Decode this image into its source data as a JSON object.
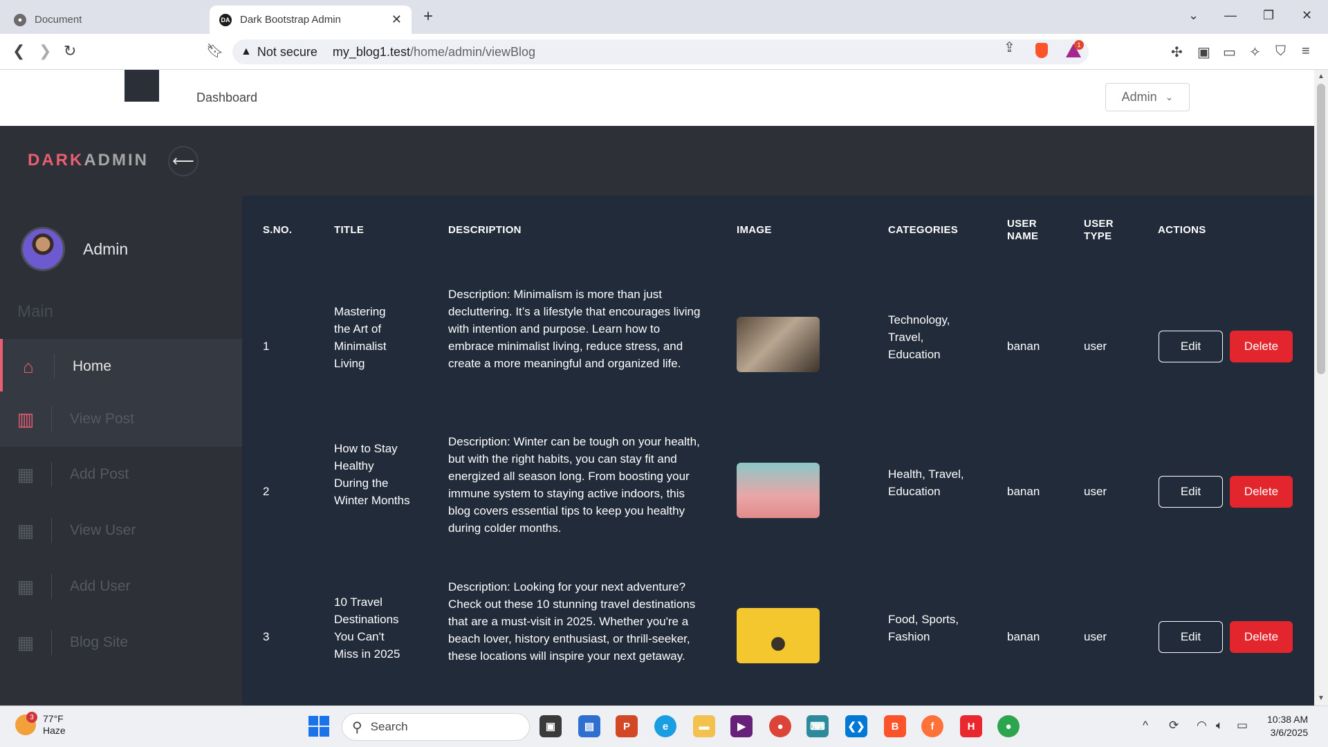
{
  "browser": {
    "tabs": [
      {
        "title": "Document",
        "active": false
      },
      {
        "title": "Dark Bootstrap Admin",
        "active": true,
        "favicon": "DA"
      }
    ],
    "address": {
      "security": "Not secure",
      "host": "my_blog1.test",
      "path": "/home/admin/viewBlog"
    },
    "rewards_badge": "1"
  },
  "topnav": {
    "link": "Dashboard",
    "admin_menu": "Admin"
  },
  "brand": {
    "part1": "DARK",
    "part2": "ADMIN"
  },
  "sidebar": {
    "profile_name": "Admin",
    "section": "Main",
    "items": [
      {
        "label": "Home",
        "icon": "home-icon"
      },
      {
        "label": "View Post",
        "icon": "bar-chart-icon"
      },
      {
        "label": "Add Post",
        "icon": "grid-icon"
      },
      {
        "label": "View User",
        "icon": "grid-icon"
      },
      {
        "label": "Add User",
        "icon": "grid-icon"
      },
      {
        "label": "Blog Site",
        "icon": "grid-icon"
      }
    ]
  },
  "table": {
    "headers": [
      "S.NO.",
      "TITLE",
      "DESCRIPTION",
      "IMAGE",
      "CATEGORIES",
      "USER NAME",
      "USER TYPE",
      "ACTIONS"
    ],
    "edit_label": "Edit",
    "delete_label": "Delete",
    "rows": [
      {
        "sno": "1",
        "title": "Mastering the Art of Minimalist Living",
        "description": "Description: Minimalism is more than just decluttering. It’s a lifestyle that encourages living with intention and purpose. Learn how to embrace minimalist living, reduce stress, and create a more meaningful and organized life.",
        "image": "photo-people-icon",
        "categories": "Technology, Travel, Education",
        "user_name": "banan",
        "user_type": "user"
      },
      {
        "sno": "2",
        "title": "How to Stay Healthy During the Winter Months",
        "description": "Description: Winter can be tough on your health, but with the right habits, you can stay fit and energized all season long. From boosting your immune system to staying active indoors, this blog covers essential tips to keep you healthy during colder months.",
        "image": "photo-lightbulb-icon",
        "categories": "Health, Travel, Education",
        "user_name": "banan",
        "user_type": "user"
      },
      {
        "sno": "3",
        "title": "10 Travel Destinations You Can't Miss in 2025",
        "description": "Description: Looking for your next adventure? Check out these 10 stunning travel destinations that are a must-visit in 2025. Whether you're a beach lover, history enthusiast, or thrill-seeker, these locations will inspire your next getaway.",
        "image": "photo-cactus-icon",
        "categories": "Food, Sports, Fashion",
        "user_name": "banan",
        "user_type": "user"
      }
    ]
  },
  "taskbar": {
    "weather_temp": "77°F",
    "weather_desc": "Haze",
    "weather_badge": "3",
    "search_placeholder": "Search",
    "time": "10:38 AM",
    "date": "3/6/2025"
  }
}
